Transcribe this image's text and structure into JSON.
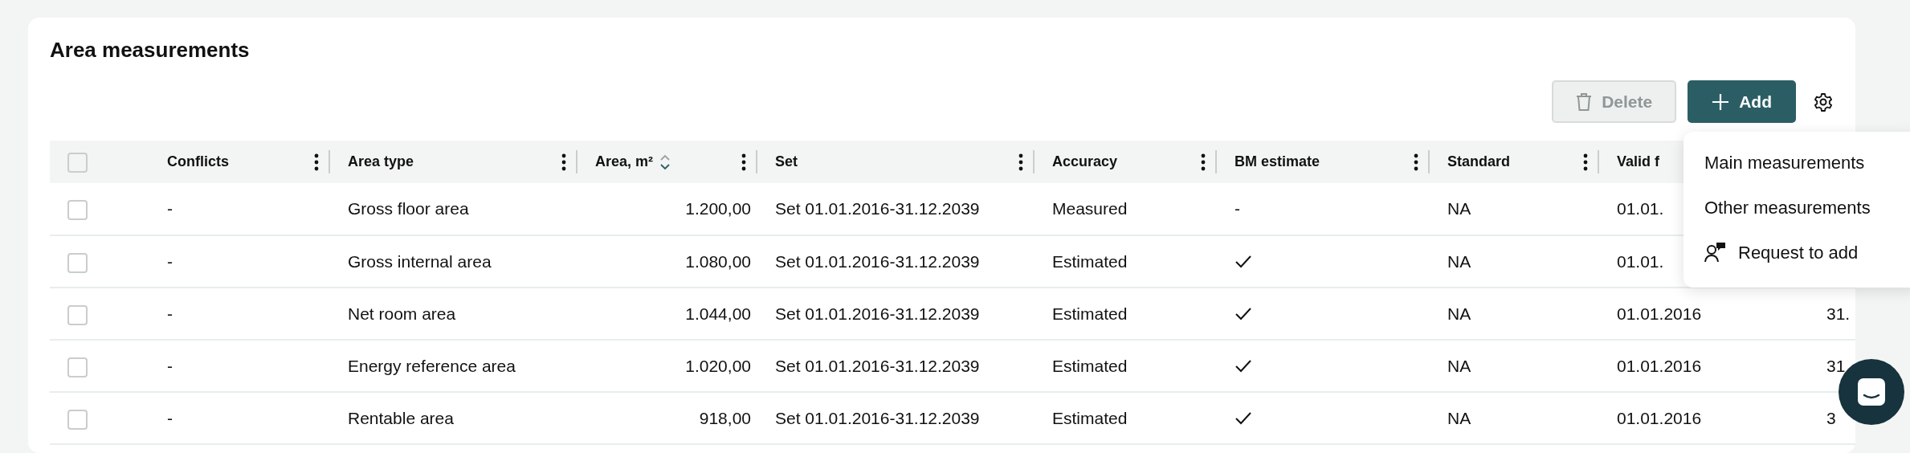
{
  "title": "Area measurements",
  "toolbar": {
    "buttons": [
      {
        "kind": "delete",
        "label": "Delete",
        "disabled": true
      },
      {
        "kind": "add",
        "label": "Add",
        "disabled": false
      }
    ]
  },
  "table": {
    "select_all": {
      "checked": false
    },
    "columns": [
      {
        "label": "Conflicts",
        "sortable": false,
        "kind": "text"
      },
      {
        "label": "Area type",
        "sortable": false,
        "kind": "text"
      },
      {
        "label": "Area, m²",
        "sortable": true,
        "kind": "number"
      },
      {
        "label": "Set",
        "sortable": false,
        "kind": "text"
      },
      {
        "label": "Accuracy",
        "sortable": false,
        "kind": "text"
      },
      {
        "label": "BM estimate",
        "sortable": false,
        "kind": "text"
      },
      {
        "label": "Standard",
        "sortable": false,
        "kind": "text"
      },
      {
        "label": "Valid f",
        "sortable": false,
        "kind": "text"
      },
      {
        "kind": "text"
      }
    ],
    "rows": [
      {
        "selected": false,
        "cells": [
          {
            "kind": "text",
            "text": "-"
          },
          {
            "kind": "text",
            "text": "Gross floor area"
          },
          {
            "kind": "text",
            "text": "1.200,00"
          },
          {
            "kind": "text",
            "text": "Set 01.01.2016-31.12.2039"
          },
          {
            "kind": "text",
            "text": "Measured"
          },
          {
            "kind": "text",
            "text": "-"
          },
          {
            "kind": "text",
            "text": "NA"
          },
          {
            "kind": "text",
            "text": "01.01."
          }
        ]
      },
      {
        "selected": false,
        "cells": [
          {
            "kind": "text",
            "text": "-"
          },
          {
            "kind": "text",
            "text": "Gross internal area"
          },
          {
            "kind": "text",
            "text": "1.080,00"
          },
          {
            "kind": "text",
            "text": "Set 01.01.2016-31.12.2039"
          },
          {
            "kind": "text",
            "text": "Estimated"
          },
          {
            "kind": "check"
          },
          {
            "kind": "text",
            "text": "NA"
          },
          {
            "kind": "text",
            "text": "01.01."
          }
        ]
      },
      {
        "selected": false,
        "cells": [
          {
            "kind": "text",
            "text": "-"
          },
          {
            "kind": "text",
            "text": "Net room area"
          },
          {
            "kind": "text",
            "text": "1.044,00"
          },
          {
            "kind": "text",
            "text": "Set 01.01.2016-31.12.2039"
          },
          {
            "kind": "text",
            "text": "Estimated"
          },
          {
            "kind": "check"
          },
          {
            "kind": "text",
            "text": "NA"
          },
          {
            "kind": "text",
            "text": "01.01.2016"
          },
          {
            "kind": "text",
            "text": "31."
          }
        ]
      },
      {
        "selected": false,
        "cells": [
          {
            "kind": "text",
            "text": "-"
          },
          {
            "kind": "text",
            "text": "Energy reference area"
          },
          {
            "kind": "text",
            "text": "1.020,00"
          },
          {
            "kind": "text",
            "text": "Set 01.01.2016-31.12.2039"
          },
          {
            "kind": "text",
            "text": "Estimated"
          },
          {
            "kind": "check"
          },
          {
            "kind": "text",
            "text": "NA"
          },
          {
            "kind": "text",
            "text": "01.01.2016"
          },
          {
            "kind": "text",
            "text": "31"
          }
        ]
      },
      {
        "selected": false,
        "cells": [
          {
            "kind": "text",
            "text": "-"
          },
          {
            "kind": "text",
            "text": "Rentable area"
          },
          {
            "kind": "text",
            "text": "918,00"
          },
          {
            "kind": "text",
            "text": "Set 01.01.2016-31.12.2039"
          },
          {
            "kind": "text",
            "text": "Estimated"
          },
          {
            "kind": "check"
          },
          {
            "kind": "text",
            "text": "NA"
          },
          {
            "kind": "text",
            "text": "01.01.2016"
          },
          {
            "kind": "text",
            "text": "3"
          }
        ]
      }
    ]
  },
  "add_menu": {
    "items": [
      {
        "kind": "plain",
        "label": "Main measurements"
      },
      {
        "kind": "plain",
        "label": "Other measurements"
      },
      {
        "kind": "request",
        "label": "Request to add"
      }
    ]
  }
}
